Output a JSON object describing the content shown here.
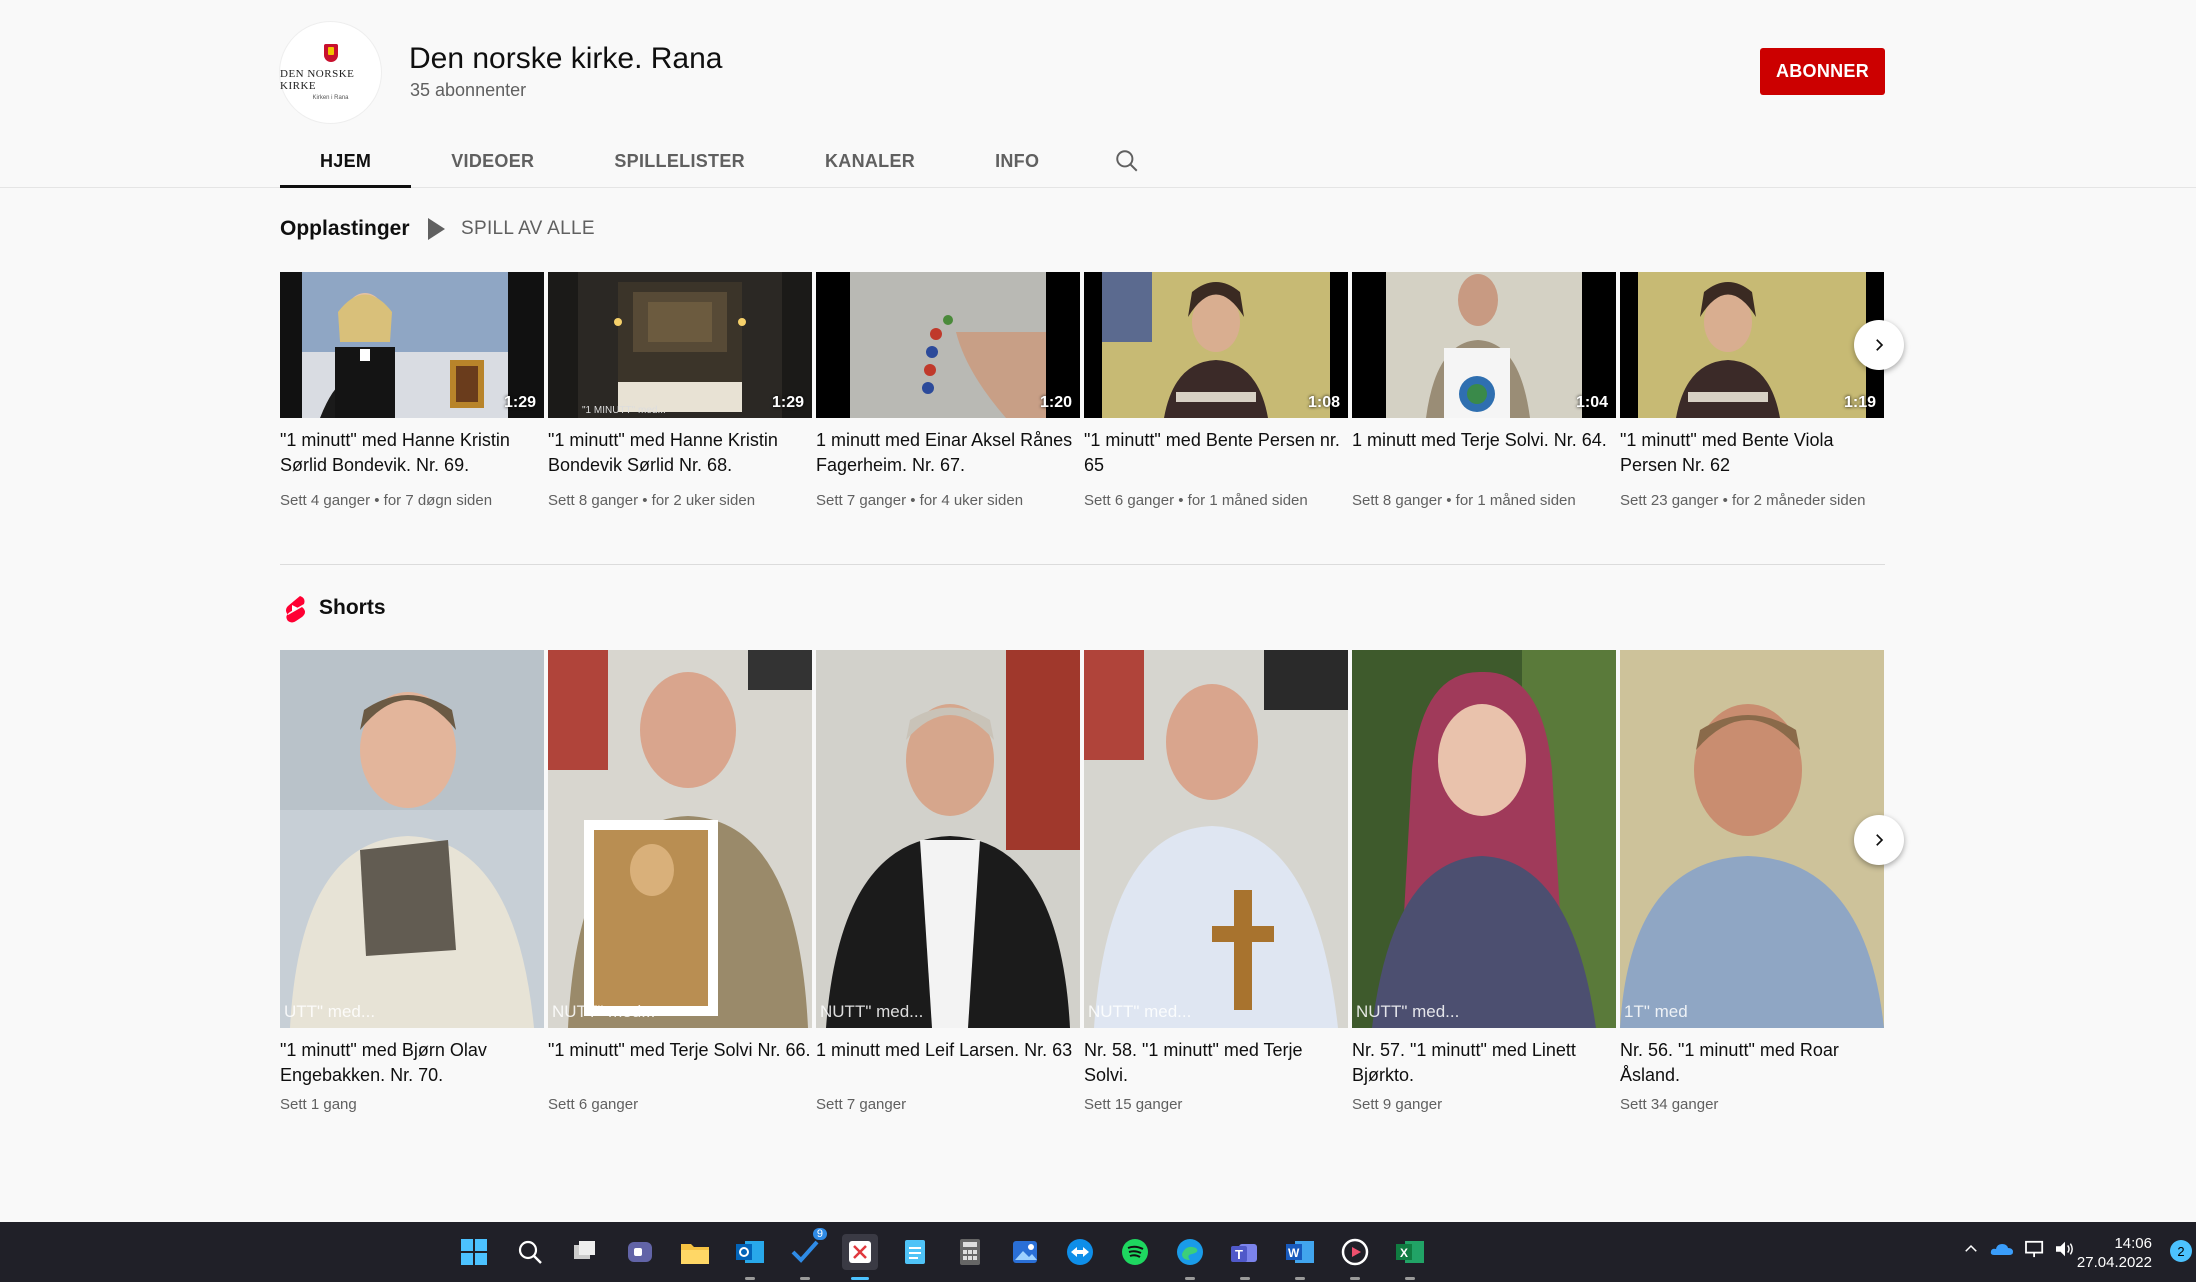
{
  "channel": {
    "name": "Den norske kirke. Rana",
    "subscribers": "35 abonnenter",
    "logo_text": "DEN NORSKE KIRKE",
    "logo_sub": "Kirken i Rana",
    "subscribe_label": "ABONNER"
  },
  "tabs": [
    "HJEM",
    "VIDEOER",
    "SPILLELISTER",
    "KANALER",
    "INFO"
  ],
  "uploads": {
    "heading": "Opplastinger",
    "play_all": "SPILL AV ALLE",
    "videos": [
      {
        "title": "\"1 minutt\" med Hanne Kristin Sørlid Bondevik. Nr. 69.",
        "duration": "1:29",
        "meta": "Sett 4 ganger • for 7 døgn siden"
      },
      {
        "title": "\"1 minutt\" med Hanne Kristin Bondevik Sørlid Nr. 68.",
        "duration": "1:29",
        "meta": "Sett 8 ganger • for 2 uker siden"
      },
      {
        "title": "1 minutt med Einar Aksel Rånes Fagerheim. Nr. 67.",
        "duration": "1:20",
        "meta": "Sett 7 ganger • for 4 uker siden"
      },
      {
        "title": "\"1 minutt\" med Bente Persen nr. 65",
        "duration": "1:08",
        "meta": "Sett 6 ganger • for 1 måned siden"
      },
      {
        "title": "1 minutt med Terje Solvi. Nr. 64.",
        "duration": "1:04",
        "meta": "Sett 8 ganger • for 1 måned siden"
      },
      {
        "title": "\"1 minutt\" med Bente Viola Persen Nr. 62",
        "duration": "1:19",
        "meta": "Sett 23 ganger • for 2 måneder siden"
      }
    ],
    "thumb_overlay_2": "\"1 MINUTT\" med..."
  },
  "shorts": {
    "heading": "Shorts",
    "videos": [
      {
        "title": "\"1 minutt\" med Bjørn Olav Engebakken. Nr. 70.",
        "meta": "Sett 1 gang",
        "overlay": "UTT\" med..."
      },
      {
        "title": "\"1 minutt\" med Terje Solvi Nr. 66.",
        "meta": "Sett 6 ganger",
        "overlay": "NUTT\" med..."
      },
      {
        "title": "1 minutt med Leif Larsen. Nr. 63",
        "meta": "Sett 7 ganger",
        "overlay": "NUTT\" med..."
      },
      {
        "title": "Nr. 58. \"1 minutt\" med Terje Solvi.",
        "meta": "Sett 15 ganger",
        "overlay": "NUTT\" med..."
      },
      {
        "title": "Nr. 57. \"1 minutt\" med Linett Bjørkto.",
        "meta": "Sett 9 ganger",
        "overlay": "NUTT\" med..."
      },
      {
        "title": "Nr. 56. \"1 minutt\" med Roar Åsland.",
        "meta": "Sett 34 ganger",
        "overlay": "1T\" med"
      }
    ]
  },
  "taskbar": {
    "time": "14:06",
    "date": "27.04.2022",
    "badge": "9",
    "notif": "2"
  },
  "colors": {
    "subscribe": "#cc0000",
    "taskbar": "#202028",
    "accent": "#4cc2ff"
  }
}
